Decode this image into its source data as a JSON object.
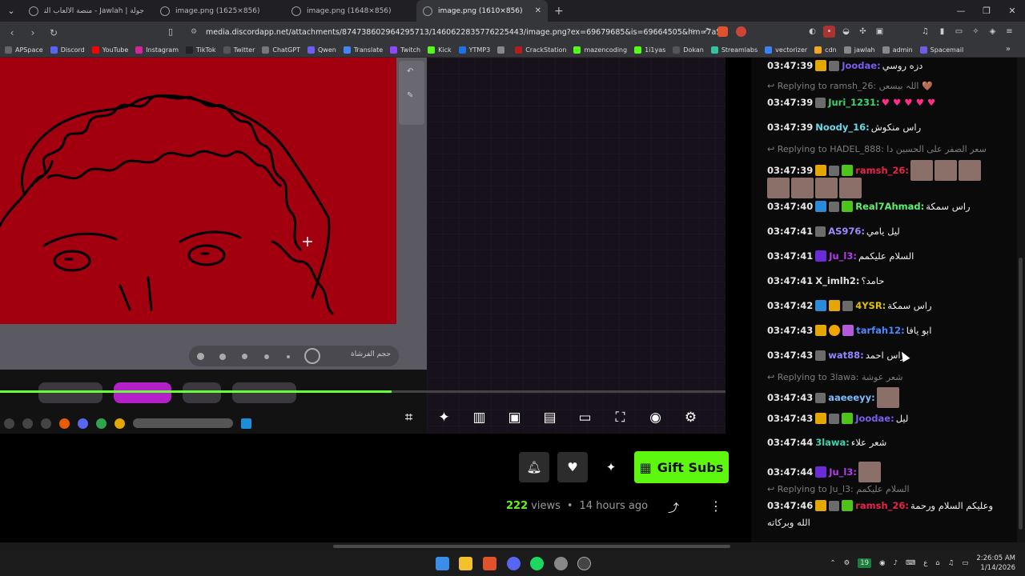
{
  "tabs": [
    {
      "title": "جولة | Jawlah - منصة الألعاب التفاعلية",
      "active": false
    },
    {
      "title": "image.png (1625×856)",
      "active": false
    },
    {
      "title": "image.png (1648×856)",
      "active": false
    },
    {
      "title": "image.png (1610×856)",
      "active": true
    }
  ],
  "address": {
    "url": "media.discordapp.net/attachments/874738602964295713/1460622835776225443/image.png?ex=69679685&is=69664505&hm=7a5cf059032a..."
  },
  "bookmarks": [
    {
      "label": "APSpace",
      "color": "#666"
    },
    {
      "label": "Discord",
      "color": "#5865f2"
    },
    {
      "label": "YouTube",
      "color": "#ff0000"
    },
    {
      "label": "Instagram",
      "color": "#d6249f"
    },
    {
      "label": "TikTok",
      "color": "#222"
    },
    {
      "label": "Twitter",
      "color": "#555"
    },
    {
      "label": "ChatGPT",
      "color": "#777"
    },
    {
      "label": "Qwen",
      "color": "#6e5ff0"
    },
    {
      "label": "Translate",
      "color": "#4285f4"
    },
    {
      "label": "Twitch",
      "color": "#9146ff"
    },
    {
      "label": "Kick",
      "color": "#53fc18"
    },
    {
      "label": "YTMP3",
      "color": "#1a73e8"
    },
    {
      "label": "",
      "color": "#888"
    },
    {
      "label": "CrackStation",
      "color": "#b71c1c"
    },
    {
      "label": "mazencoding",
      "color": "#53fc18"
    },
    {
      "label": "1i1yas",
      "color": "#53fc18"
    },
    {
      "label": "Dokan",
      "color": "#555"
    },
    {
      "label": "Streamlabs",
      "color": "#31c3a2"
    },
    {
      "label": "vectorizer",
      "color": "#3b82f6"
    },
    {
      "label": "cdn",
      "color": "#f5a623"
    },
    {
      "label": "jawlah",
      "color": "#888"
    },
    {
      "label": "admin",
      "color": "#888"
    },
    {
      "label": "Spacemail",
      "color": "#6c5ce7"
    }
  ],
  "player": {
    "progress": 0.54
  },
  "actions": {
    "gift_label": "Gift Subs"
  },
  "meta": {
    "views_count": "222",
    "views_label": "views",
    "dot": "•",
    "ago": "14 hours ago"
  },
  "chat": {
    "messages": [
      {
        "time": "03:47:39",
        "user": "Joodae:",
        "color": "#7e5bef",
        "text": "دزه روسي"
      },
      {
        "reply": "Replying to ramsh_26: اللہ بیسعں 🤎"
      },
      {
        "time": "03:47:39",
        "user": "Juri_1231:",
        "color": "#35d56e",
        "text": "♥ ♥ ♥ ♥ ♥"
      },
      {
        "time": "03:47:39",
        "user": "Noody_16:",
        "color": "#6fd6e8",
        "text": "راس منكوش"
      },
      {
        "reply": "Replying to HADEL_888: سعر الصفر على الحسين دا"
      },
      {
        "time": "03:47:39",
        "user": "ramsh_26:",
        "color": "#e8234a",
        "text": ""
      },
      {
        "time": "03:47:40",
        "user": "Real7Ahmad:",
        "color": "#5ef070",
        "text": "راس سمكة"
      },
      {
        "time": "03:47:41",
        "user": "AS976:",
        "color": "#9b8bff",
        "text": "ليل يامي"
      },
      {
        "time": "03:47:41",
        "user": "Ju_l3:",
        "color": "#b23ee8",
        "text": "السلام عليكمم"
      },
      {
        "time": "03:47:41",
        "user": "X_imlh2:",
        "color": "#e0e0e0",
        "text": "حامد؟"
      },
      {
        "time": "03:47:42",
        "user": "4YSR:",
        "color": "#e0c000",
        "text": "راس سمكة"
      },
      {
        "time": "03:47:43",
        "user": "tarfah12:",
        "color": "#4d87ff",
        "text": "ابو يافا"
      },
      {
        "time": "03:47:43",
        "user": "wat88:",
        "color": "#8f85ff",
        "text": "راس احمد"
      },
      {
        "reply": "Replying to 3lawa: شعر عوشة"
      },
      {
        "time": "03:47:43",
        "user": "aaeeeyy:",
        "color": "#7dbbff",
        "text": ""
      },
      {
        "time": "03:47:43",
        "user": "Joodae:",
        "color": "#7e5bef",
        "text": "ليل"
      },
      {
        "time": "03:47:44",
        "user": "3lawa:",
        "color": "#35d5b0",
        "text": "شعر علاء"
      },
      {
        "time": "03:47:44",
        "user": "Ju_l3:",
        "color": "#b23ee8",
        "text": ""
      },
      {
        "reply": "Replying to Ju_l3: السلام عليكمم"
      },
      {
        "time": "03:47:46",
        "user": "ramsh_26:",
        "color": "#e8234a",
        "text": "وعليكم السلام ورحمة"
      },
      {
        "cont": "الله وبركاته"
      }
    ]
  },
  "taskbar": {
    "time": "2:26:05 AM",
    "date": "1/14/2026",
    "lang": "ع",
    "badge": "19"
  },
  "brush": {
    "label": "حجم الفرشاة"
  }
}
